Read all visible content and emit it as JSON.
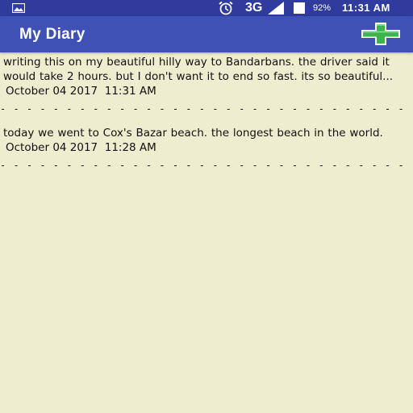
{
  "status_bar": {
    "network": "3G",
    "battery": "92%",
    "time": "11:31 AM"
  },
  "app_bar": {
    "title": "My Diary",
    "add_icon": "add-plus-icon"
  },
  "entries": [
    {
      "text": "writing this on my beautiful hilly way to Bandarbans. the driver said it would take 2 hours. but I don't want it to end so fast. its so beautiful...",
      "date": "October 04 2017  11:31 AM"
    },
    {
      "text": "today we went to Cox's Bazar beach. the longest beach in the world.",
      "date": "October 04 2017  11:28 AM"
    }
  ],
  "divider": "- - - - - - - - - - - - - - - - - - - - - - - - - - - - - - - - - - - - - - -",
  "colors": {
    "status_bar": "#2f3c9e",
    "app_bar": "#3f51b5",
    "background": "#efedcf",
    "add_icon_green": "#3cb44a"
  }
}
